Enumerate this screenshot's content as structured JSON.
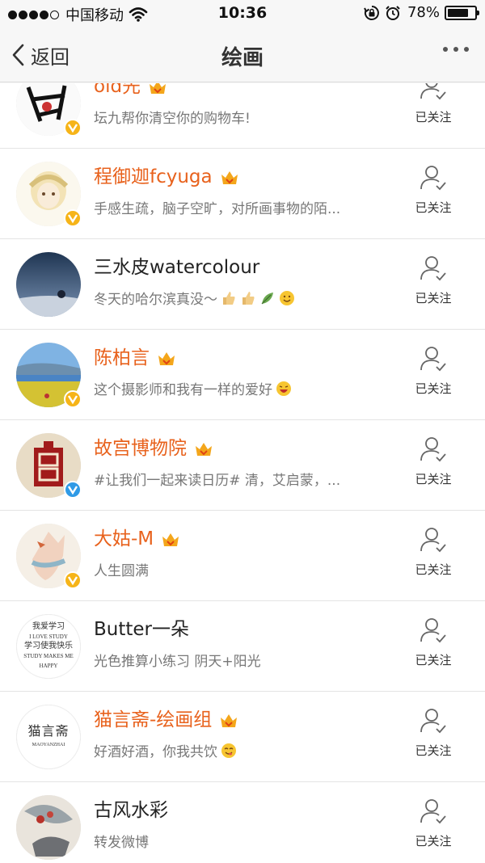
{
  "status_bar": {
    "carrier": "中国移动",
    "time": "10:36",
    "battery_pct": "78%",
    "battery_level": 0.78,
    "signal_bars": 4
  },
  "nav": {
    "back_label": "返回",
    "title": "绘画"
  },
  "colors": {
    "vip_name": "#e8621d",
    "badge_orange": "#f6b418",
    "badge_blue": "#2f9ae6"
  },
  "users": [
    {
      "name": "old先",
      "desc": "坛九帮你清空你的购物车!",
      "follow_label": "已关注"
    },
    {
      "name": "程御迦fcyuga",
      "desc": "手感生疏，脑子空旷，对所画事物的陌...",
      "follow_label": "已关注"
    },
    {
      "name": "三水皮watercolour",
      "desc": "冬天的哈尔滨真没～",
      "follow_label": "已关注"
    },
    {
      "name": "陈柏言",
      "desc": "这个摄影师和我有一样的爱好",
      "follow_label": "已关注"
    },
    {
      "name": "故宫博物院",
      "desc": "#让我们一起来读日历# 清，艾启蒙，...",
      "follow_label": "已关注"
    },
    {
      "name": "大姑-M",
      "desc": "人生圆满",
      "follow_label": "已关注"
    },
    {
      "name": "Butter一朵",
      "desc": "光色推算小练习 阴天+阳光",
      "follow_label": "已关注"
    },
    {
      "name": "猫言斋-绘画组",
      "desc": "好酒好酒，你我共饮",
      "follow_label": "已关注"
    },
    {
      "name": "古风水彩",
      "desc": "转发微博",
      "follow_label": "已关注"
    }
  ],
  "avatar_texts": {
    "butter": [
      "我爱学习",
      "I LOVE STUDY",
      "学习使我快乐",
      "STUDY MAKES ME",
      "HAPPY"
    ],
    "maoyanzhai": [
      "猫言斋",
      "MAOYANZHAI"
    ]
  }
}
